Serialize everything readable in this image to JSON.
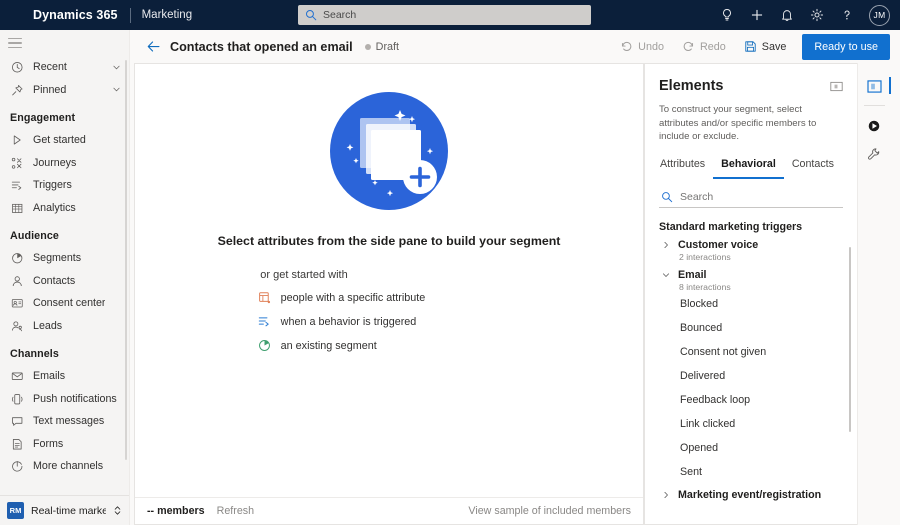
{
  "topbar": {
    "brand": "Dynamics 365",
    "app_name": "Marketing",
    "search_placeholder": "Search",
    "icons": [
      {
        "name": "lightbulb-icon",
        "label": "Insights"
      },
      {
        "name": "plus-icon",
        "label": "New"
      },
      {
        "name": "bell-icon",
        "label": "Notifications"
      },
      {
        "name": "gear-icon",
        "label": "Settings"
      },
      {
        "name": "question-icon",
        "label": "Help"
      }
    ],
    "avatar_initials": "JM"
  },
  "sidebar": {
    "hamburger_label": "Show nav pane",
    "top_items": [
      {
        "label": "Recent",
        "icon": "clock-icon",
        "expandable": true
      },
      {
        "label": "Pinned",
        "icon": "pin-icon",
        "expandable": true
      }
    ],
    "groups": [
      {
        "header": "Engagement",
        "items": [
          {
            "label": "Get started",
            "icon": "play-outline-icon"
          },
          {
            "label": "Journeys",
            "icon": "journeys-icon"
          },
          {
            "label": "Triggers",
            "icon": "triggers-icon"
          },
          {
            "label": "Analytics",
            "icon": "analytics-icon"
          }
        ]
      },
      {
        "header": "Audience",
        "items": [
          {
            "label": "Segments",
            "icon": "segments-icon"
          },
          {
            "label": "Contacts",
            "icon": "contact-icon"
          },
          {
            "label": "Consent center",
            "icon": "consent-icon"
          },
          {
            "label": "Leads",
            "icon": "leads-icon"
          }
        ]
      },
      {
        "header": "Channels",
        "items": [
          {
            "label": "Emails",
            "icon": "envelope-icon"
          },
          {
            "label": "Push notifications",
            "icon": "phone-icon"
          },
          {
            "label": "Text messages",
            "icon": "chat-icon"
          },
          {
            "label": "Forms",
            "icon": "form-icon"
          },
          {
            "label": "More channels",
            "icon": "more-channels-icon"
          }
        ]
      }
    ],
    "area_switcher": {
      "badge": "RM",
      "label": "Real-time marketi..."
    }
  },
  "command_bar": {
    "back_label": "Back",
    "title": "Contacts that opened an email",
    "status": "Draft",
    "undo_label": "Undo",
    "redo_label": "Redo",
    "save_label": "Save",
    "primary_label": "Ready to use"
  },
  "canvas": {
    "empty_title": "Select attributes from the side pane to build your segment",
    "empty_subtitle": "or get started with",
    "options": [
      {
        "label": "people with a specific attribute",
        "icon": "attribute-icon",
        "color": "#e8845a"
      },
      {
        "label": "when a behavior is triggered",
        "icon": "trigger-icon",
        "color": "#2b7cd3"
      },
      {
        "label": "an existing segment",
        "icon": "segment-icon",
        "color": "#3f9f6f"
      }
    ],
    "footer": {
      "members_count": "-- members",
      "refresh_label": "Refresh",
      "view_sample_label": "View sample of included members"
    }
  },
  "elements_panel": {
    "title": "Elements",
    "collapse_label": "Collapse pane",
    "description": "To construct your segment, select attributes and/or specific members to include or exclude.",
    "tabs": [
      {
        "label": "Attributes",
        "active": false
      },
      {
        "label": "Behavioral",
        "active": true
      },
      {
        "label": "Contacts",
        "active": false
      }
    ],
    "search_placeholder": "Search",
    "group_header": "Standard marketing triggers",
    "nodes": [
      {
        "label": "Customer voice",
        "sub": "2 interactions",
        "expanded": false,
        "children": []
      },
      {
        "label": "Email",
        "sub": "8 interactions",
        "expanded": true,
        "children": [
          "Blocked",
          "Bounced",
          "Consent not given",
          "Delivered",
          "Feedback loop",
          "Link clicked",
          "Opened",
          "Sent"
        ]
      },
      {
        "label": "Marketing event/registration",
        "sub": "",
        "expanded": false,
        "children": []
      }
    ]
  },
  "right_rail": {
    "buttons": [
      {
        "name": "elements-pane-icon",
        "label": "Elements",
        "active": true
      },
      {
        "name": "copilot-icon",
        "label": "Copilot",
        "active": false
      },
      {
        "name": "tools-icon",
        "label": "Tools",
        "active": false
      }
    ]
  },
  "theme": {
    "topbar_bg": "#0b1f3a",
    "accent": "#1170cf",
    "illustration_blue": "#2b64d9"
  }
}
